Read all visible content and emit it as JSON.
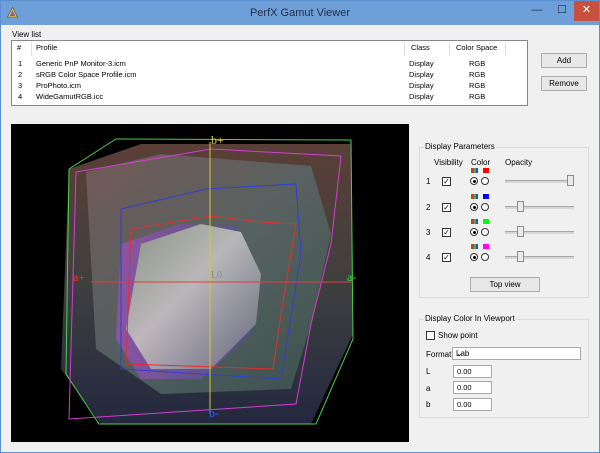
{
  "window": {
    "title": "PerfX Gamut Viewer",
    "minimize": "—",
    "maximize": "☐",
    "close": "✕"
  },
  "view_list": {
    "label": "View list",
    "columns": [
      "#",
      "Profile",
      "Class",
      "Color Space"
    ],
    "rows": [
      [
        "1",
        "Generic PnP Monitor-3.icm",
        "Display",
        "RGB"
      ],
      [
        "2",
        "sRGB Color Space Profile.icm",
        "Display",
        "RGB"
      ],
      [
        "3",
        "ProPhoto.icm",
        "Display",
        "RGB"
      ],
      [
        "4",
        "WideGamutRGB.icc",
        "Display",
        "RGB"
      ]
    ]
  },
  "buttons": {
    "add": "Add",
    "remove": "Remove",
    "top_view": "Top view"
  },
  "viewport": {
    "axis_b_plus": "b+",
    "axis_b_minus": "b-",
    "axis_a_plus": "a+",
    "axis_a_minus": "a-",
    "center": "L0"
  },
  "display_parameters": {
    "title": "Display Parameters",
    "visibility_header": "Visibility",
    "color_header": "Color",
    "opacity_header": "Opacity",
    "rows": [
      {
        "index": "1",
        "visible": true,
        "color": "#ff0000",
        "mode": "multi",
        "opacity": 1.0
      },
      {
        "index": "2",
        "visible": true,
        "color": "#0000ff",
        "mode": "multi",
        "opacity": 0.25
      },
      {
        "index": "3",
        "visible": true,
        "color": "#00ff00",
        "mode": "multi",
        "opacity": 0.25
      },
      {
        "index": "4",
        "visible": true,
        "color": "#ff00ff",
        "mode": "multi",
        "opacity": 0.25
      }
    ]
  },
  "display_color": {
    "title": "Display Color In Viewport",
    "show_point": "Show point",
    "format_label": "Format",
    "format_value": "Lab",
    "fields": [
      {
        "label": "L",
        "value": "0.00"
      },
      {
        "label": "a",
        "value": "0.00"
      },
      {
        "label": "b",
        "value": "0.00"
      }
    ]
  }
}
